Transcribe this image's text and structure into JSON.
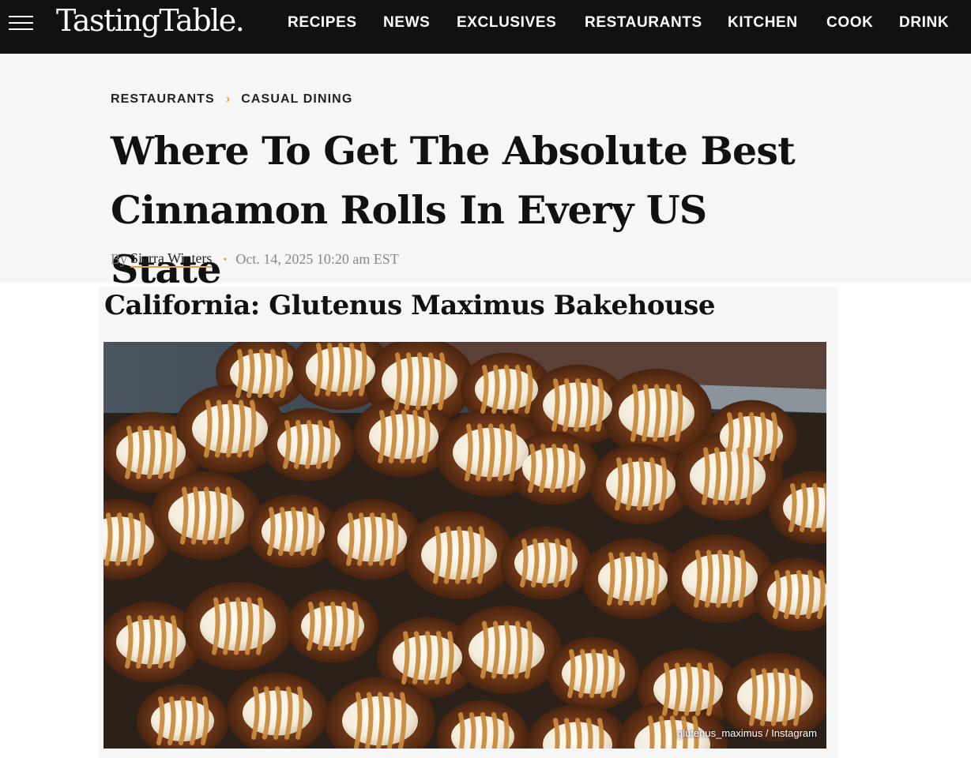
{
  "site": {
    "logo": "TastingTable.",
    "nav": [
      "RECIPES",
      "NEWS",
      "EXCLUSIVES",
      "RESTAURANTS",
      "KITCHEN",
      "COOK",
      "DRINK"
    ]
  },
  "breadcrumb": {
    "items": [
      "RESTAURANTS",
      "CASUAL DINING"
    ],
    "separator_icon": "chevron-right-icon"
  },
  "article": {
    "title_line1": "Where To Get The Absolute Best",
    "title_line2": "Cinnamon Rolls In Every US State",
    "by": "By",
    "author": "Sierra Winters",
    "date": "Oct. 14, 2025 10:20 am EST"
  },
  "section": {
    "heading": "California: Glutenus Maximus Bakehouse",
    "photo_credit": "glutenus_maximus / Instagram"
  },
  "colors": {
    "nav_bg": "#111111",
    "accent": "#e8a23b",
    "header_bg": "#f6f6f6"
  }
}
